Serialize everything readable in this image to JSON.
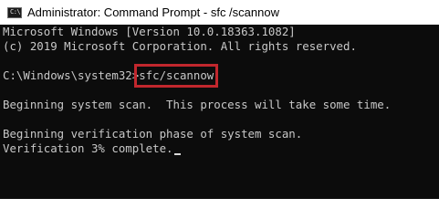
{
  "window": {
    "title": "Administrator: Command Prompt - sfc /scannow",
    "icon": "command-prompt-icon",
    "icon_glyph": "C:\\"
  },
  "console": {
    "line1": "Microsoft Windows [Version 10.0.18363.1082]",
    "line2": "(c) 2019 Microsoft Corporation. All rights reserved.",
    "prompt": "C:\\Windows\\system32>",
    "command": "sfc/scannow",
    "line4": "Beginning system scan.  This process will take some time.",
    "line5": "Beginning verification phase of system scan.",
    "line6": "Verification 3% complete."
  },
  "colors": {
    "console_bg": "#0c0c0c",
    "console_text": "#c8c8c8",
    "highlight_box": "#c1272d"
  }
}
